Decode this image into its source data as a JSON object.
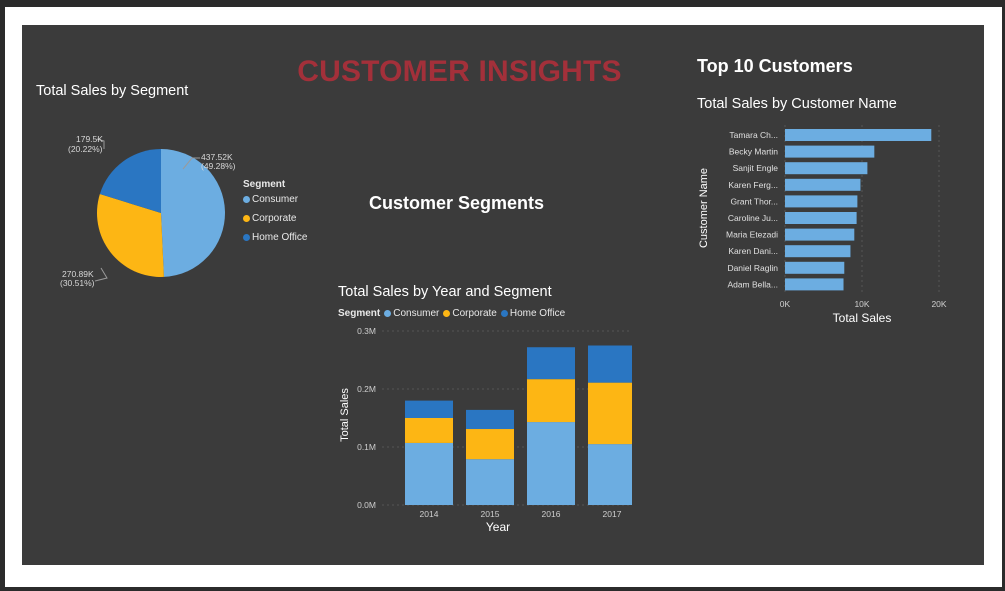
{
  "header": {
    "title": "CUSTOMER INSIGHTS"
  },
  "colors": {
    "consumer": "#6cade1",
    "corporate": "#fdb614",
    "home_office": "#2a76c2",
    "title": "#a3303a",
    "background": "#3b3b3b"
  },
  "pie": {
    "title": "Total Sales by Segment",
    "legend_title": "Segment",
    "legend": [
      "Consumer",
      "Corporate",
      "Home Office"
    ],
    "labels": [
      {
        "value": "437.52K",
        "pct": "(49.28%)"
      },
      {
        "value": "270.89K",
        "pct": "(30.51%)"
      },
      {
        "value": "179.5K",
        "pct": "(20.22%)"
      }
    ]
  },
  "segments_heading": "Customer Segments",
  "stacked": {
    "title": "Total Sales by Year and Segment",
    "legend_title": "Segment",
    "legend": [
      "Consumer",
      "Corporate",
      "Home Office"
    ],
    "ylabel": "Total Sales",
    "xlabel": "Year",
    "yticks": [
      "0.3M",
      "0.2M",
      "0.1M",
      "0.0M"
    ]
  },
  "top10": {
    "heading": "Top 10 Customers",
    "title": "Total Sales by Customer Name",
    "ylabel": "Customer Name",
    "xlabel": "Total Sales",
    "xticks": [
      "0K",
      "10K",
      "20K"
    ]
  },
  "chart_data": [
    {
      "type": "pie",
      "title": "Total Sales by Segment",
      "categories": [
        "Consumer",
        "Corporate",
        "Home Office"
      ],
      "values": [
        437520,
        270890,
        179500
      ],
      "percents": [
        49.28,
        30.51,
        20.22
      ],
      "legend_position": "right"
    },
    {
      "type": "bar",
      "stacked": true,
      "title": "Total Sales by Year and Segment",
      "xlabel": "Year",
      "ylabel": "Total Sales",
      "categories": [
        "2014",
        "2015",
        "2016",
        "2017"
      ],
      "ylim": [
        0,
        300000
      ],
      "series": [
        {
          "name": "Consumer",
          "values": [
            107000,
            79000,
            143000,
            105000
          ]
        },
        {
          "name": "Corporate",
          "values": [
            43000,
            52000,
            74000,
            106000
          ]
        },
        {
          "name": "Home Office",
          "values": [
            30000,
            33000,
            55000,
            64000
          ]
        }
      ],
      "legend_position": "top-left"
    },
    {
      "type": "bar",
      "orientation": "horizontal",
      "title": "Total Sales by Customer Name",
      "xlabel": "Total Sales",
      "ylabel": "Customer Name",
      "categories": [
        "Tamara Ch...",
        "Becky Martin",
        "Sanjit Engle",
        "Karen Ferg...",
        "Grant Thor...",
        "Caroline Ju...",
        "Maria Etezadi",
        "Karen Dani...",
        "Daniel Raglin",
        "Adam Bella..."
      ],
      "values": [
        19000,
        11600,
        10700,
        9800,
        9400,
        9300,
        9000,
        8500,
        7700,
        7600
      ],
      "xlim": [
        0,
        20000
      ],
      "xticks": [
        0,
        10000,
        20000
      ]
    }
  ]
}
